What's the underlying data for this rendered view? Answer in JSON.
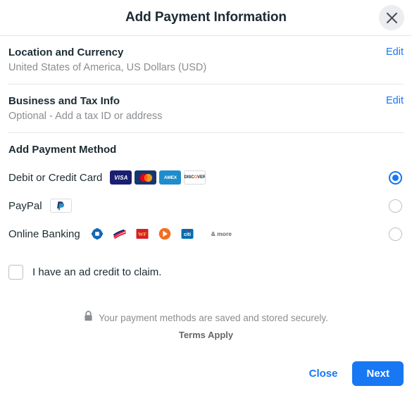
{
  "header": {
    "title": "Add Payment Information",
    "close_icon": "close-icon"
  },
  "sections": [
    {
      "title": "Location and Currency",
      "subtitle": "United States of America, US Dollars (USD)",
      "edit_label": "Edit"
    },
    {
      "title": "Business and Tax Info",
      "subtitle": "Optional - Add a tax ID or address",
      "edit_label": "Edit"
    }
  ],
  "payment": {
    "title": "Add Payment Method",
    "methods": [
      {
        "label": "Debit or Credit Card",
        "selected": true,
        "logos": [
          "visa",
          "mastercard",
          "amex",
          "discover"
        ],
        "logo_text": {
          "visa": "VISA",
          "amex": "AMEX",
          "discover_a": "DISC",
          "discover_o": "O",
          "discover_b": "VER"
        }
      },
      {
        "label": "PayPal",
        "selected": false,
        "logos": [
          "paypal"
        ]
      },
      {
        "label": "Online Banking",
        "selected": false,
        "logos": [
          "chase",
          "bank-of-america",
          "wells-fargo",
          "discover-bank",
          "citi"
        ],
        "more_label": "& more",
        "wf_text": "WF",
        "citi_text": "citi"
      }
    ]
  },
  "ad_credit": {
    "label": "I have an ad credit to claim.",
    "checked": false
  },
  "secure": {
    "icon": "lock-icon",
    "text": "Your payment methods are saved and stored securely.",
    "terms": "Terms Apply"
  },
  "footer": {
    "close_label": "Close",
    "next_label": "Next"
  },
  "colors": {
    "accent": "#1877f2",
    "text": "#1c2b33",
    "muted": "#8a8d91",
    "divider": "#e4e6eb"
  }
}
